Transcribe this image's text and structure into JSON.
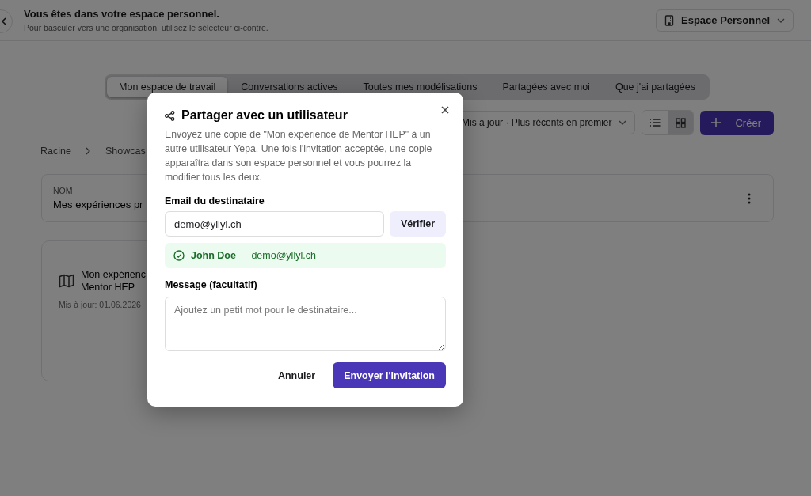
{
  "header": {
    "title": "Vous êtes dans votre espace personnel.",
    "subtitle": "Pour basculer vers une organisation, utilisez le sélecteur ci-contre.",
    "workspace_selector": "Espace Personnel"
  },
  "tabs": [
    {
      "label": "Mon espace de travail",
      "selected": true
    },
    {
      "label": "Conversations actives",
      "selected": false
    },
    {
      "label": "Toutes mes modélisations",
      "selected": false
    },
    {
      "label": "Partagées avec moi",
      "selected": false
    },
    {
      "label": "Que j'ai partagées",
      "selected": false
    }
  ],
  "sort": {
    "value": "Mis à jour · Plus récents en premier"
  },
  "view_modes": [
    {
      "kind": "list",
      "selected": false
    },
    {
      "kind": "grid",
      "selected": true
    }
  ],
  "create_button": "Créer",
  "breadcrumb": [
    "Racine",
    "Showcas"
  ],
  "name_card": {
    "label": "NOM",
    "value": "Mes expériences pr"
  },
  "items": [
    {
      "title_lines": [
        "Mon expérienc",
        "Mentor HEP"
      ],
      "updated": "Mis à jour: 01.06.2026"
    }
  ],
  "dialog": {
    "title": "Partager avec un utilisateur",
    "description": "Envoyez une copie de \"Mon expérience de Mentor HEP\" à un autre utilisateur Yepa. Une fois l'invitation acceptée, une copie apparaîtra dans son espace personnel et vous pourrez la modifier tous les deux.",
    "email_label": "Email du destinataire",
    "email_value": "demo@yllyl.ch",
    "verify_button": "Vérifier",
    "verification": {
      "verified": true,
      "text": "**John Doe** — demo@yllyl.ch"
    },
    "message_label": "Message (facultatif)",
    "message_placeholder": "Ajoutez un petit mot pour le destinataire...",
    "cancel_button": "Annuler",
    "submit_button": "Envoyer l'invitation"
  }
}
